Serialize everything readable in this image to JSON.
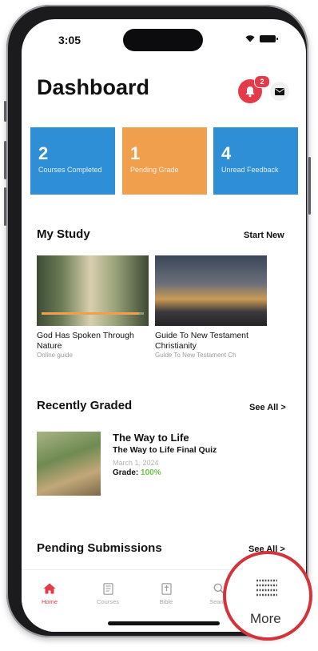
{
  "status": {
    "time": "3:05"
  },
  "header": {
    "title": "Dashboard",
    "notification_count": "2"
  },
  "stats": [
    {
      "number": "2",
      "label": "Courses Completed",
      "color": "#2f8fd6"
    },
    {
      "number": "1",
      "label": "Pending Grade",
      "color": "#f0a04d"
    },
    {
      "number": "4",
      "label": "Unread Feedback",
      "color": "#2f8fd6"
    }
  ],
  "my_study": {
    "title": "My Study",
    "action": "Start New",
    "items": [
      {
        "title": "God Has Spoken Through Nature",
        "subtitle": "Online guide",
        "progress": 0.95
      },
      {
        "title": "Guide To New Testament Christianity",
        "subtitle": "Guide To New Testament Ch",
        "progress": 0
      }
    ]
  },
  "recently_graded": {
    "title": "Recently Graded",
    "action": "See All >",
    "item": {
      "course": "The Way to Life",
      "quiz": "The Way to Life Final Quiz",
      "date": "March 1, 2024",
      "grade_label": "Grade:",
      "grade_value": "100%"
    }
  },
  "pending": {
    "title": "Pending Submissions",
    "action": "See All >"
  },
  "tabbar": {
    "tabs": [
      {
        "label": "Home",
        "icon": "home-icon",
        "active": true
      },
      {
        "label": "Courses",
        "icon": "book-icon",
        "active": false
      },
      {
        "label": "Bible",
        "icon": "bible-icon",
        "active": false
      },
      {
        "label": "Search",
        "icon": "search-icon",
        "active": false
      }
    ],
    "more_label": "More"
  },
  "colors": {
    "accent_red": "#e53a4a",
    "blue": "#2f8fd6",
    "orange": "#f0a04d",
    "grade_green": "#6cc44a",
    "highlight_circle": "#d3333b"
  }
}
